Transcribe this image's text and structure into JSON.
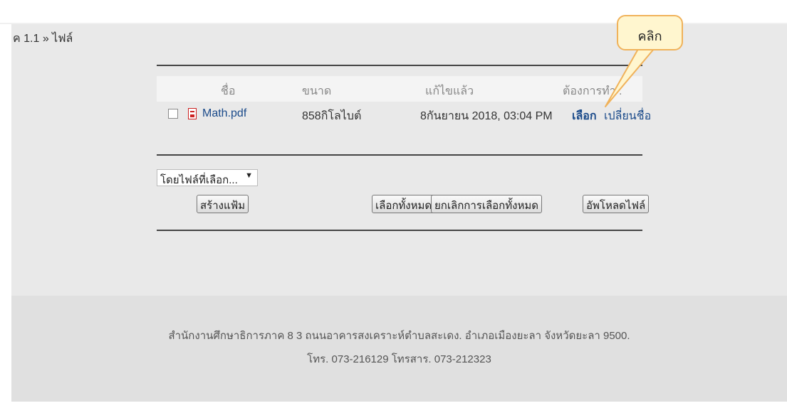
{
  "breadcrumb": {
    "text": "ค 1.1 » ไฟล์"
  },
  "table": {
    "headers": {
      "name": "ชื่อ",
      "size": "ขนาด",
      "modified": "แก้ไขแล้ว",
      "actions": "ต้องการทำ ."
    },
    "rows": [
      {
        "name": "Math.pdf",
        "size": "858กิโลไบต์",
        "modified": "8กันยายน 2018, 03:04 PM",
        "action_select": "เลือก",
        "action_rename": "เปลี่ยนชื่อ"
      }
    ]
  },
  "controls": {
    "with_selected": "โดยไฟล์ที่เลือก...",
    "create_folder": "สร้างแฟ้ม",
    "select_all": "เลือกทั้งหมด",
    "deselect_all": "ยกเลิกการเลือกทั้งหมด",
    "upload": "อัพโหลดไฟล์"
  },
  "callout": {
    "text": "คลิก"
  },
  "footer": {
    "address": "สำนักงานศึกษาธิการภาค 8 3 ถนนอาคารสงเคราะห์ตำบลสะเดง. อำเภอเมืองยะลา จังหวัดยะลา 9500.",
    "phone": "โทร. 073-216129 โทรสาร. 073-212323"
  },
  "colors": {
    "link": "#1a4a8a",
    "callout_fill": "#fff6cf",
    "callout_border": "#f0b25a"
  }
}
